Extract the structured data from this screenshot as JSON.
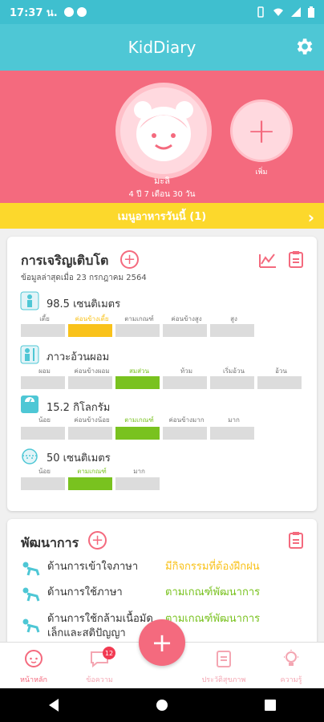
{
  "status_bar": {
    "time": "17:37 น."
  },
  "app": {
    "title": "KidDiary"
  },
  "child": {
    "name": "มะลิ",
    "age": "4 ปี 7 เดือน 30 วัน",
    "add_label": "เพิ่ม"
  },
  "food_bar": {
    "label": "เมนูอาหารวันนี้ (1)"
  },
  "growth": {
    "title": "การเจริญเติบโต",
    "updated": "ข้อมูลล่าสุดเมื่อ 23 กรกฎาคม 2564",
    "metrics": [
      {
        "value": "98.5 เซนติเมตร",
        "scale": [
          "เตี้ย",
          "ค่อนข้างเตี้ย",
          "ตามเกณฑ์",
          "ค่อนข้างสูง",
          "สูง"
        ],
        "active": 1,
        "active_color": "#f9c21a"
      },
      {
        "value": "ภาวะอ้วนผอม",
        "scale": [
          "ผอม",
          "ค่อนข้างผอม",
          "สมส่วน",
          "ท้วม",
          "เริ่มอ้วน",
          "อ้วน"
        ],
        "active": 2,
        "active_color": "#79c21f"
      },
      {
        "value": "15.2 กิโลกรัม",
        "scale": [
          "น้อย",
          "ค่อนข้างน้อย",
          "ตามเกณฑ์",
          "ค่อนข้างมาก",
          "มาก"
        ],
        "active": 2,
        "active_color": "#79c21f"
      },
      {
        "value": "50 เซนติเมตร",
        "scale": [
          "น้อย",
          "ตามเกณฑ์",
          "มาก"
        ],
        "active": 1,
        "active_color": "#79c21f"
      }
    ]
  },
  "development": {
    "title": "พัฒนาการ",
    "items": [
      {
        "name": "ด้านการเข้าใจภาษา",
        "status": "มีกิจกรรมที่ต้องฝึกฝน",
        "status_color": "#f9c21a"
      },
      {
        "name": "ด้านการใช้ภาษา",
        "status": "ตามเกณฑ์พัฒนาการ",
        "status_color": "#79c21f"
      },
      {
        "name": "ด้านการใช้กล้ามเนื้อมัด",
        "name2": "เล็กและสติปัญญา",
        "status": "ตามเกณฑ์พัฒนาการ",
        "status_color": "#79c21f"
      }
    ]
  },
  "nav": {
    "home": "หน้าหลัก",
    "messages": "ข้อความ",
    "messages_badge": "12",
    "records": "ประวัติสุขภาพ",
    "knowledge": "ความรู้"
  }
}
